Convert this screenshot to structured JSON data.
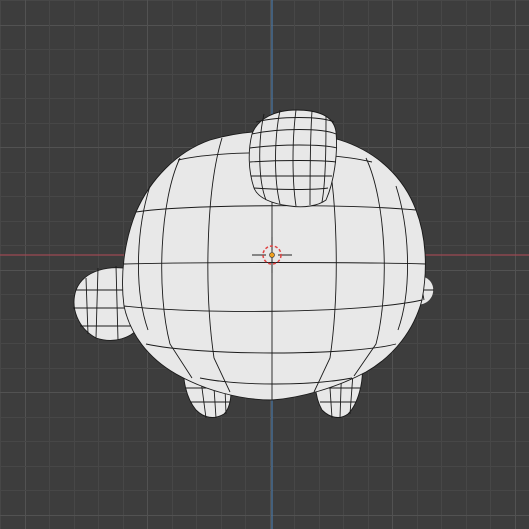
{
  "viewport": {
    "background_color": "#3d3d3d",
    "grid_minor_color": "#474747",
    "grid_major_color": "#525252",
    "x_axis_color": "#9c4a52",
    "y_axis_color": "#4a77a6",
    "mesh_fill_color": "#e8e8e8",
    "wire_color": "#1a1a1a",
    "cursor_color": "#e04444",
    "origin_color": "#f0a020"
  },
  "object": {
    "icon": "turtle-mesh-icon",
    "parts": [
      "shell",
      "head",
      "tail",
      "front-left-leg",
      "front-right-leg",
      "back-leg"
    ]
  },
  "tools": {
    "cursor_icon": "3d-cursor-icon",
    "origin_icon": "object-origin-icon"
  }
}
